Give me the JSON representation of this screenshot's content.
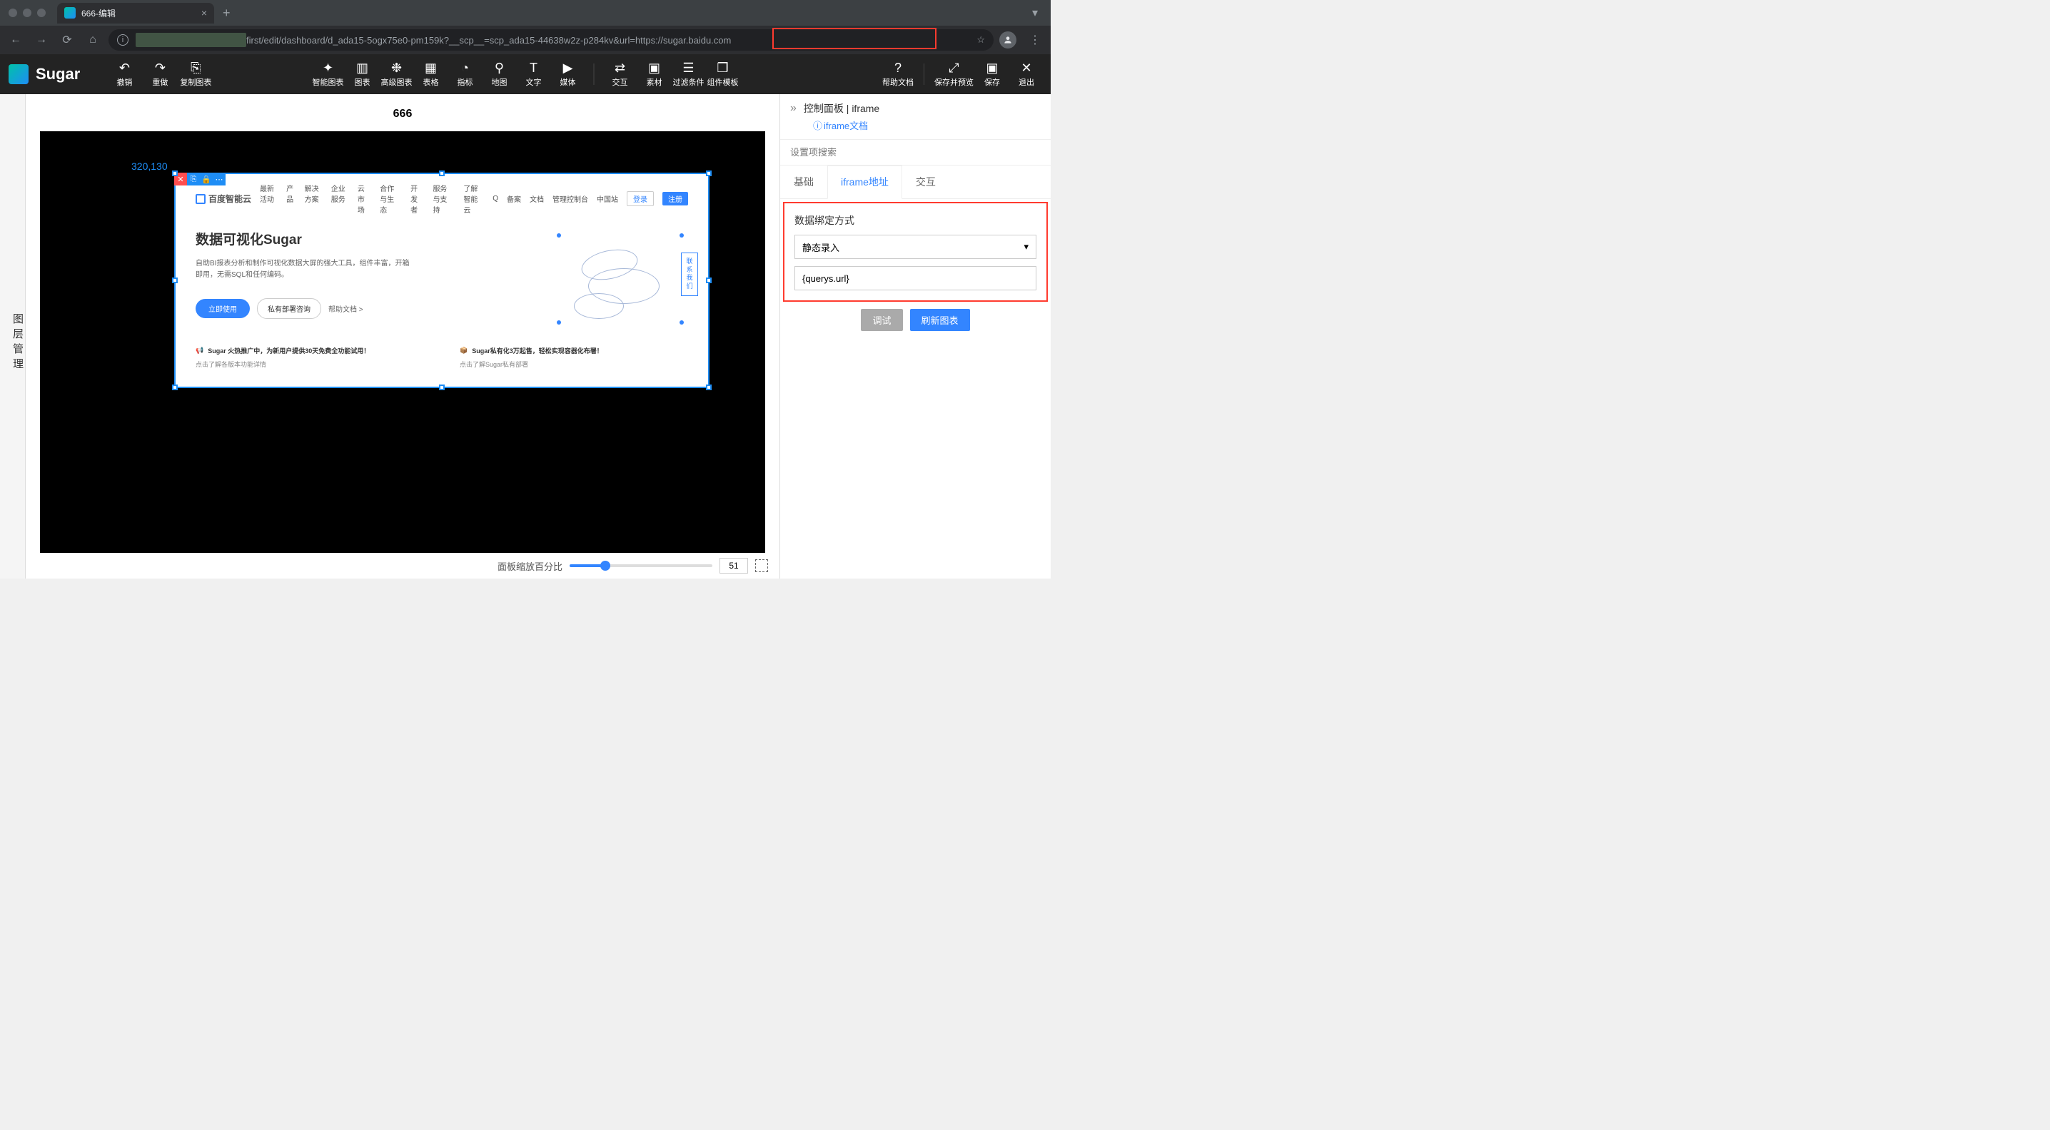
{
  "browser": {
    "tab_title": "666-编辑",
    "url_suffix": "first/edit/dashboard/d_ada15-5ogx75e0-pm159k?__scp__=scp_ada15-44638w2z-p284kv&url=https://sugar.baidu.com"
  },
  "app": {
    "brand": "Sugar",
    "toolbar": {
      "undo": "撤销",
      "redo": "重做",
      "copy_chart": "复制图表",
      "smart_chart": "智能图表",
      "chart": "图表",
      "adv_chart": "高级图表",
      "table": "表格",
      "indicator": "指标",
      "map": "地图",
      "text": "文字",
      "media": "媒体",
      "interaction": "交互",
      "material": "素材",
      "filter": "过滤条件",
      "component_tpl": "组件模板",
      "help": "帮助文档",
      "save_preview": "保存并预览",
      "save": "保存",
      "exit": "退出"
    }
  },
  "layers_rail": "图层管理",
  "canvas": {
    "title": "666",
    "coordinate": "320,130"
  },
  "embedded": {
    "logo_text": "百度智能云",
    "nav": [
      "最新活动",
      "产品",
      "解决方案",
      "企业服务",
      "云市场",
      "合作与生态",
      "开发者",
      "服务与支持",
      "了解智能云"
    ],
    "right_nav_search": "Q",
    "right_nav": [
      "备案",
      "文档",
      "管理控制台",
      "中国站"
    ],
    "login": "登录",
    "register": "注册",
    "hero_title": "数据可视化Sugar",
    "hero_desc": "自助BI报表分析和制作可视化数据大屏的强大工具，组件丰富，开箱即用，无需SQL和任何编码。",
    "btn_primary": "立即使用",
    "btn_outline": "私有部署咨询",
    "help_link": "帮助文档 >",
    "contact": "联系我们",
    "promo1_title": "Sugar 火热推广中，为新用户提供30天免费全功能试用！",
    "promo1_sub": "点击了解各版本功能详情",
    "promo2_title": "Sugar私有化3万起售，轻松实现容器化布署！",
    "promo2_sub": "点击了解Sugar私有部署"
  },
  "zoom": {
    "label": "面板缩放百分比",
    "value": "51"
  },
  "panel": {
    "title": "控制面板 | iframe",
    "doc_link": "iframe文档",
    "search_placeholder": "设置项搜索",
    "tabs": {
      "basic": "基础",
      "iframe_url": "iframe地址",
      "interaction": "交互"
    },
    "active_tab": "iframe_url",
    "binding_label": "数据绑定方式",
    "binding_select_value": "静态录入",
    "url_value": "{querys.url}",
    "btn_debug": "调试",
    "btn_refresh": "刷新图表"
  }
}
